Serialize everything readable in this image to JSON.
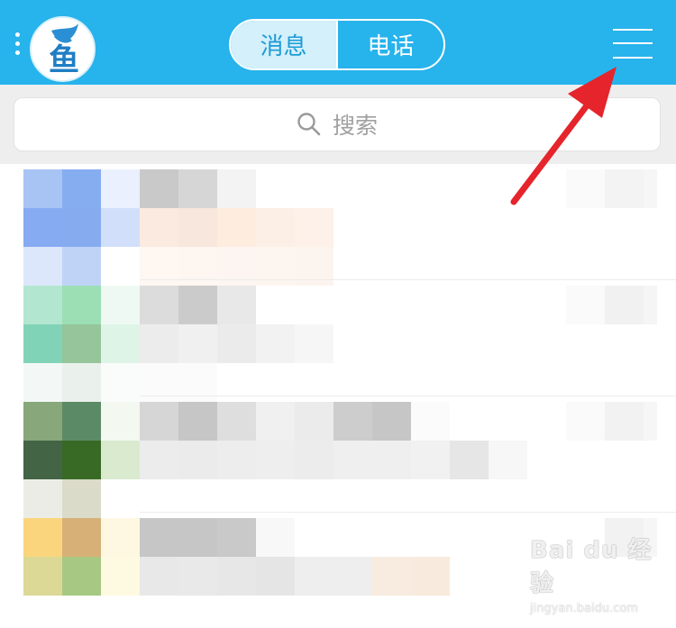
{
  "header": {
    "logo_char": "鱼",
    "tabs": [
      {
        "label": "消息",
        "active": true
      },
      {
        "label": "电话",
        "active": false
      }
    ],
    "menu_icon": "hamburger-menu-icon",
    "more_icon": "vertical-dots-icon"
  },
  "search": {
    "placeholder": "搜索",
    "icon": "search-icon"
  },
  "conversations": [
    {
      "avatar_colors": [
        "#a8c4f4",
        "#86adf0",
        "#eaf0fd",
        "#87abf2",
        "#86acef",
        "#d2dffa",
        "#dde7fb",
        "#bfd3f7",
        "#ffffff"
      ]
    },
    {
      "avatar_colors": [
        "#b3e6d1",
        "#9cdfb4",
        "#eff9f3",
        "#81d3b7",
        "#96c49b",
        "#def4e7",
        "#f3f8f7",
        "#eaf1ec",
        "#fafcfb"
      ]
    },
    {
      "avatar_colors": [
        "#88a77b",
        "#5b8b66",
        "#f3f8f1",
        "#436445",
        "#386a26",
        "#d9eacf",
        "#ecece6",
        "#dadbc8",
        "#ffffff"
      ]
    },
    {
      "avatar_colors": [
        "#fad57e",
        "#d7b078",
        "#fef8e2",
        "#dbd995",
        "#a7c882",
        "#fefae1",
        "#f0f0f0",
        "#f0f0f0",
        "#ffffff"
      ]
    }
  ],
  "colors": {
    "header_bg": "#27b3ec",
    "accent": "#1d9ad6",
    "arrow": "#e5242b"
  },
  "watermark": {
    "logo": "Bai du 经验",
    "url": "jingyan.baidu.com"
  }
}
